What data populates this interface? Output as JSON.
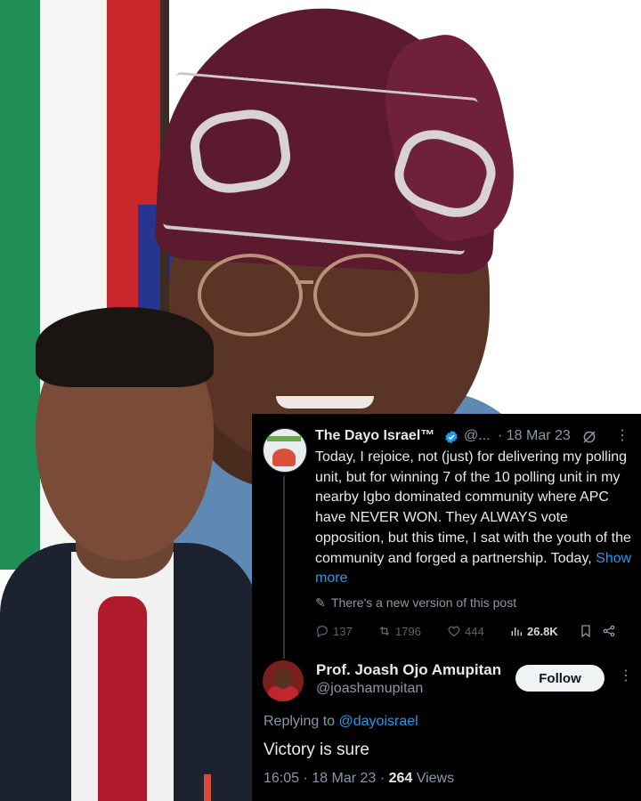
{
  "tweet": {
    "author_name": "The Dayo Israel™",
    "author_handle_truncated": "@...",
    "date_sep": "·",
    "date": "18 Mar 23",
    "body_text": "Today, I rejoice, not (just) for delivering my polling unit, but for winning 7 of the 10 polling unit in my nearby Igbo dominated community where APC have NEVER WON. They ALWAYS vote opposition, but this time, I sat with the youth of the community and forged a partnership. Today,",
    "show_more": "Show more",
    "new_version_notice": "There's a new version of this post",
    "stats": {
      "replies": "137",
      "reposts": "1796",
      "likes": "444",
      "views": "26.8K"
    }
  },
  "reply": {
    "author_name": "Prof. Joash Ojo Amupitan",
    "author_handle": "@joashamupitan",
    "follow_label": "Follow",
    "replying_to_label": "Replying to",
    "replying_to_handle": "@dayoisrael",
    "text": "Victory is sure",
    "time": "16:05",
    "date": "18 Mar 23",
    "sep": "·",
    "views_count": "264",
    "views_label": "Views"
  },
  "icons": {
    "verified": "verified-badge-icon",
    "grok": "grok-icon",
    "more": "more-icon",
    "reply": "reply-icon",
    "repost": "repost-icon",
    "like": "like-icon",
    "views": "views-icon",
    "bookmark": "bookmark-icon",
    "share": "share-icon",
    "edit": "pencil-icon"
  },
  "colors": {
    "background": "#000000",
    "text": "#e7e9ea",
    "muted": "#8b98a5",
    "accent": "#1d9bf0",
    "verified": "#1d9bf0"
  }
}
